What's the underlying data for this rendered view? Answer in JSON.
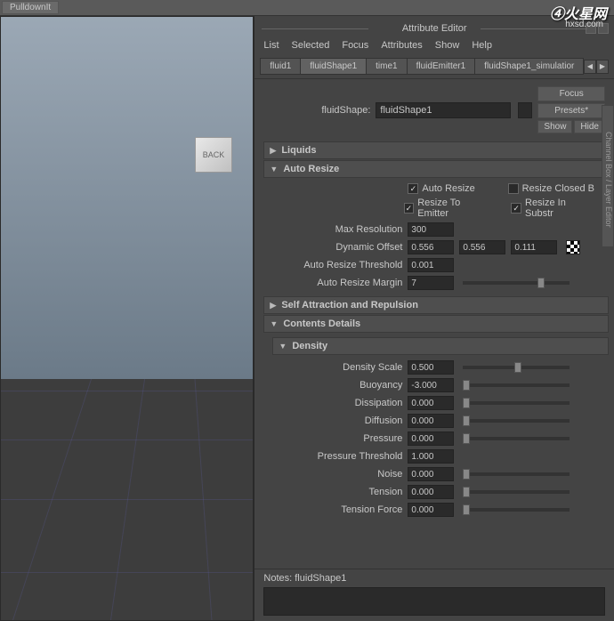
{
  "topbar": {
    "button": "PulldownIt"
  },
  "watermark": {
    "main": "④火星网",
    "sub": "hxsd.com"
  },
  "viewport": {
    "cube_label": "BACK"
  },
  "panel": {
    "title": "Attribute Editor"
  },
  "menu": {
    "list": "List",
    "selected": "Selected",
    "focus": "Focus",
    "attributes": "Attributes",
    "show": "Show",
    "help": "Help"
  },
  "tabs": [
    "fluid1",
    "fluidShape1",
    "time1",
    "fluidEmitter1",
    "fluidShape1_simulatior"
  ],
  "name_row": {
    "label": "fluidShape:",
    "value": "fluidShape1"
  },
  "side_buttons": {
    "focus": "Focus",
    "presets": "Presets*",
    "show": "Show",
    "hide": "Hide"
  },
  "sections": {
    "liquids": "Liquids",
    "auto_resize": "Auto Resize",
    "self_attraction": "Self Attraction and Repulsion",
    "contents": "Contents Details",
    "density_header": "Density"
  },
  "auto_resize": {
    "cb_auto_resize": "Auto Resize",
    "cb_resize_closed": "Resize Closed B",
    "cb_resize_emitter": "Resize To Emitter",
    "cb_resize_substr": "Resize In Substr",
    "max_resolution_label": "Max Resolution",
    "max_resolution": "300",
    "dynamic_offset_label": "Dynamic Offset",
    "dynamic_offset": [
      "0.556",
      "0.556",
      "0.111"
    ],
    "threshold_label": "Auto Resize Threshold",
    "threshold": "0.001",
    "margin_label": "Auto Resize Margin",
    "margin": "7"
  },
  "density": {
    "scale_label": "Density Scale",
    "scale": "0.500",
    "buoyancy_label": "Buoyancy",
    "buoyancy": "-3.000",
    "dissipation_label": "Dissipation",
    "dissipation": "0.000",
    "diffusion_label": "Diffusion",
    "diffusion": "0.000",
    "pressure_label": "Pressure",
    "pressure": "0.000",
    "pressure_threshold_label": "Pressure Threshold",
    "pressure_threshold": "1.000",
    "noise_label": "Noise",
    "noise": "0.000",
    "tension_label": "Tension",
    "tension": "0.000",
    "tension_force_label": "Tension Force",
    "tension_force": "0.000"
  },
  "notes": {
    "label": "Notes: fluidShape1"
  },
  "right_strip": "Channel Box / Layer Editor"
}
